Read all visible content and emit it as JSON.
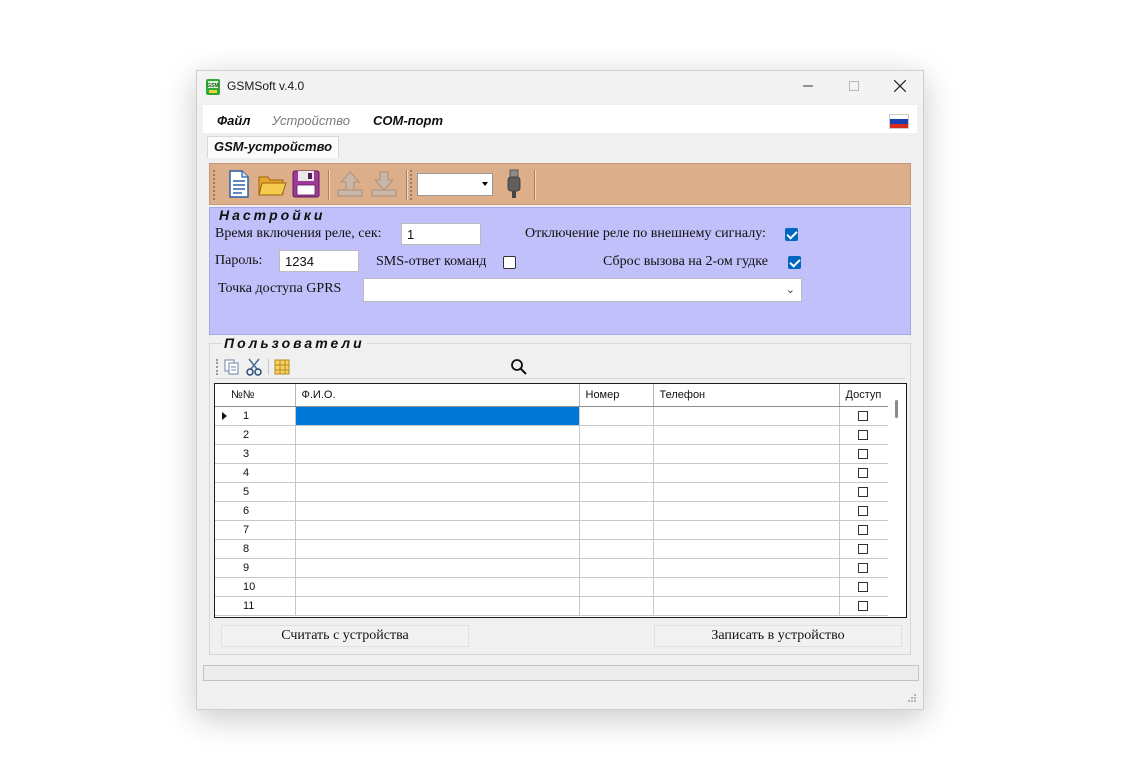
{
  "window": {
    "title": "GSMSoft v.4.0",
    "app_icon": "gsm-logo-icon",
    "controls": [
      "minimize-icon",
      "maximize-icon",
      "close-icon"
    ]
  },
  "menu": {
    "items": [
      {
        "label": "Файл",
        "enabled": true
      },
      {
        "label": "Устройство",
        "enabled": false
      },
      {
        "label": "COM-порт",
        "enabled": true
      }
    ],
    "language_icon": "russian-flag-icon"
  },
  "tab": {
    "label": "GSM-устройство"
  },
  "toolbar": {
    "icons": [
      "new-document-icon",
      "open-folder-icon",
      "save-disk-icon",
      "upload-icon",
      "download-icon",
      "usb-plug-icon"
    ],
    "port_select": {
      "value": ""
    },
    "colors": {
      "background": "#dcae8a"
    }
  },
  "settings": {
    "title": "Настройки",
    "relay_time_label": "Время включения реле, сек:",
    "relay_time_value": "1",
    "password_label": "Пароль:",
    "password_value": "1234",
    "sms_reply_label": "SMS-ответ команд",
    "sms_reply_checked": false,
    "relay_off_label": "Отключение реле по внешнему сигналу:",
    "relay_off_checked": true,
    "call_reset_label": "Сброс вызова на 2-ом гудке",
    "call_reset_checked": true,
    "gprs_label": "Точка доступа GPRS",
    "gprs_value": "",
    "colors": {
      "background": "#c2c0fa"
    }
  },
  "users": {
    "title": "Пользователи",
    "toolbar_icons": [
      "copy-icon",
      "cut-icon",
      "table-icon",
      "search-icon"
    ],
    "columns": [
      "№№",
      "Ф.И.О.",
      "Номер",
      "Телефон",
      "Доступ"
    ],
    "rows": [
      {
        "num": "1",
        "name": "",
        "number": "",
        "phone": "",
        "access": false
      },
      {
        "num": "2",
        "name": "",
        "number": "",
        "phone": "",
        "access": false
      },
      {
        "num": "3",
        "name": "",
        "number": "",
        "phone": "",
        "access": false
      },
      {
        "num": "4",
        "name": "",
        "number": "",
        "phone": "",
        "access": false
      },
      {
        "num": "5",
        "name": "",
        "number": "",
        "phone": "",
        "access": false
      },
      {
        "num": "6",
        "name": "",
        "number": "",
        "phone": "",
        "access": false
      },
      {
        "num": "7",
        "name": "",
        "number": "",
        "phone": "",
        "access": false
      },
      {
        "num": "8",
        "name": "",
        "number": "",
        "phone": "",
        "access": false
      },
      {
        "num": "9",
        "name": "",
        "number": "",
        "phone": "",
        "access": false
      },
      {
        "num": "10",
        "name": "",
        "number": "",
        "phone": "",
        "access": false
      },
      {
        "num": "11",
        "name": "",
        "number": "",
        "phone": "",
        "access": false
      }
    ],
    "selected_row": 1,
    "colors": {
      "selection": "#0078d7"
    }
  },
  "actions": {
    "read_label": "Считать с устройства",
    "write_label": "Записать в устройство"
  }
}
